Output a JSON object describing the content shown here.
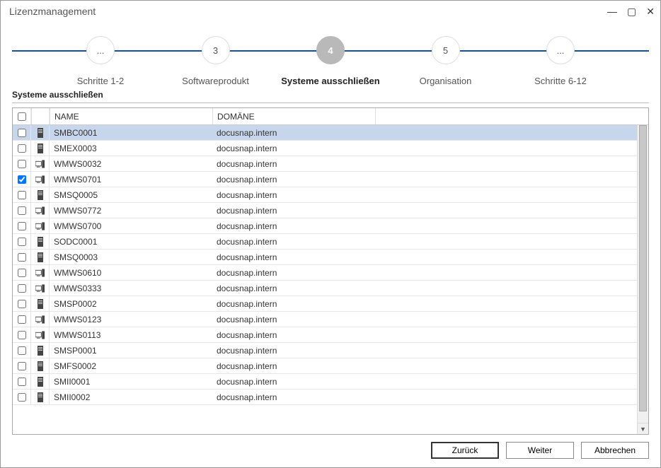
{
  "window": {
    "title": "Lizenzmanagement"
  },
  "stepper": {
    "steps": [
      {
        "num": "...",
        "label": "Schritte 1-2",
        "active": false
      },
      {
        "num": "3",
        "label": "Softwareprodukt",
        "active": false
      },
      {
        "num": "4",
        "label": "Systeme ausschließen",
        "active": true
      },
      {
        "num": "5",
        "label": "Organisation",
        "active": false
      },
      {
        "num": "...",
        "label": "Schritte 6-12",
        "active": false
      }
    ]
  },
  "section": {
    "title": "Systeme ausschließen"
  },
  "table": {
    "columns": {
      "name": "NAME",
      "domain": "DOMÄNE"
    },
    "rows": [
      {
        "checked": false,
        "selected": true,
        "icon": "server",
        "name": "SMBC0001",
        "domain": "docusnap.intern"
      },
      {
        "checked": false,
        "selected": false,
        "icon": "server",
        "name": "SMEX0003",
        "domain": "docusnap.intern"
      },
      {
        "checked": false,
        "selected": false,
        "icon": "workstation",
        "name": "WMWS0032",
        "domain": "docusnap.intern"
      },
      {
        "checked": true,
        "selected": false,
        "icon": "workstation",
        "name": "WMWS0701",
        "domain": "docusnap.intern"
      },
      {
        "checked": false,
        "selected": false,
        "icon": "server",
        "name": "SMSQ0005",
        "domain": "docusnap.intern"
      },
      {
        "checked": false,
        "selected": false,
        "icon": "workstation",
        "name": "WMWS0772",
        "domain": "docusnap.intern"
      },
      {
        "checked": false,
        "selected": false,
        "icon": "workstation",
        "name": "WMWS0700",
        "domain": "docusnap.intern"
      },
      {
        "checked": false,
        "selected": false,
        "icon": "server",
        "name": "SODC0001",
        "domain": "docusnap.intern"
      },
      {
        "checked": false,
        "selected": false,
        "icon": "server",
        "name": "SMSQ0003",
        "domain": "docusnap.intern"
      },
      {
        "checked": false,
        "selected": false,
        "icon": "workstation",
        "name": "WMWS0610",
        "domain": "docusnap.intern"
      },
      {
        "checked": false,
        "selected": false,
        "icon": "workstation",
        "name": "WMWS0333",
        "domain": "docusnap.intern"
      },
      {
        "checked": false,
        "selected": false,
        "icon": "server",
        "name": "SMSP0002",
        "domain": "docusnap.intern"
      },
      {
        "checked": false,
        "selected": false,
        "icon": "workstation",
        "name": "WMWS0123",
        "domain": "docusnap.intern"
      },
      {
        "checked": false,
        "selected": false,
        "icon": "workstation",
        "name": "WMWS0113",
        "domain": "docusnap.intern"
      },
      {
        "checked": false,
        "selected": false,
        "icon": "server",
        "name": "SMSP0001",
        "domain": "docusnap.intern"
      },
      {
        "checked": false,
        "selected": false,
        "icon": "server",
        "name": "SMFS0002",
        "domain": "docusnap.intern"
      },
      {
        "checked": false,
        "selected": false,
        "icon": "server",
        "name": "SMII0001",
        "domain": "docusnap.intern"
      },
      {
        "checked": false,
        "selected": false,
        "icon": "server",
        "name": "SMII0002",
        "domain": "docusnap.intern"
      }
    ]
  },
  "buttons": {
    "back": "Zurück",
    "next": "Weiter",
    "cancel": "Abbrechen"
  }
}
